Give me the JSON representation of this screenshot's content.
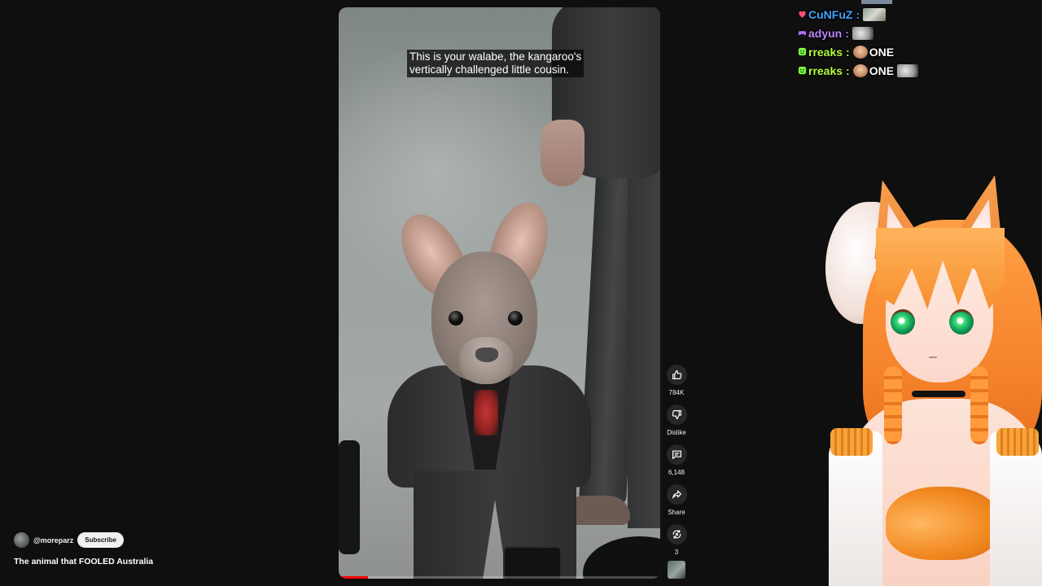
{
  "video": {
    "caption": "This is your walabe, the kangaroo's\nvertically challenged little cousin.",
    "progress_percent": 9
  },
  "actions": {
    "like_count": "784K",
    "dislike_label": "Dislike",
    "comments_count": "6,148",
    "share_label": "Share",
    "remix_count": "3"
  },
  "channel": {
    "handle": "@moreparz",
    "subscribe_label": "Subscribe"
  },
  "short_title": "The animal that FOOLED Australia",
  "chat": {
    "messages": [
      {
        "user": "CuNFuZ",
        "color": "#3ea6ff",
        "badge": "heart-icon",
        "badge_color": "#ff4f7b",
        "text": ""
      },
      {
        "user": "adyun",
        "color": "#c084fc",
        "badge": "controller-icon",
        "badge_color": "#b36bff",
        "text": ""
      },
      {
        "user": "rreaks",
        "color": "#b7ff3d",
        "badge": "smiley-icon",
        "badge_color": "#7cfc3d",
        "text": "ONE"
      },
      {
        "user": "rreaks",
        "color": "#b7ff3d",
        "badge": "smiley-icon",
        "badge_color": "#7cfc3d",
        "text": "ONE"
      }
    ]
  },
  "colors": {
    "background": "#0f0f0f",
    "progress": "#ff0000",
    "button_bg": "#272727"
  }
}
